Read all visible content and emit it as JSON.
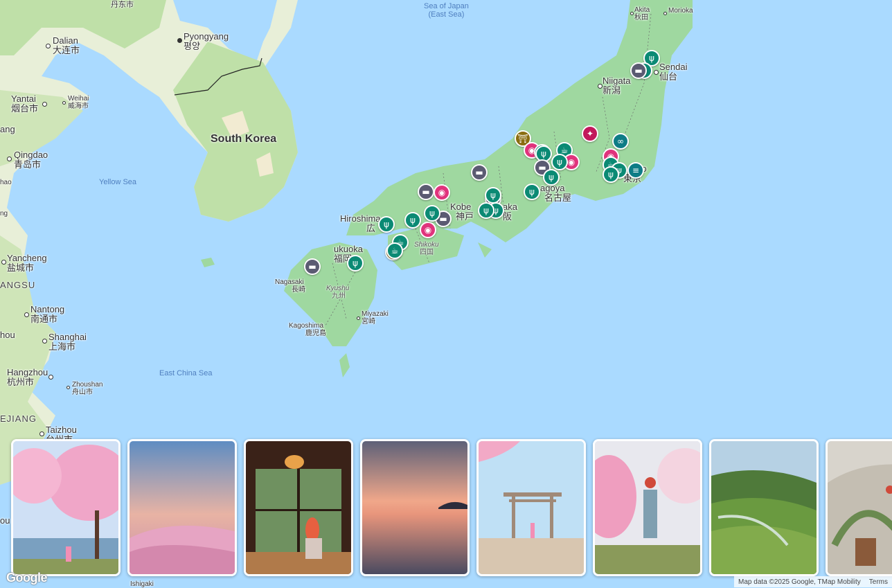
{
  "map": {
    "countries": {
      "south_korea": "South Korea"
    },
    "seas": {
      "sea_of_japan": "Sea of Japan",
      "east_sea": "(East Sea)",
      "yellow_sea": "Yellow Sea",
      "east_china_sea": "East China Sea"
    },
    "cities": {
      "dandong": {
        "name": "丹东市",
        "native": ""
      },
      "dalian": {
        "name": "Dalian",
        "native": "大连市"
      },
      "pyongyang": {
        "name": "Pyongyang",
        "native": "평양"
      },
      "yantai": {
        "name": "Yantai",
        "native": "烟台市"
      },
      "weihai": {
        "name": "Weihai",
        "native": "威海市"
      },
      "qingdao": {
        "name": "Qingdao",
        "native": "青岛市"
      },
      "yancheng": {
        "name": "Yancheng",
        "native": "盐城市"
      },
      "nantong": {
        "name": "Nantong",
        "native": "南通市"
      },
      "shanghai": {
        "name": "Shanghai",
        "native": "上海市"
      },
      "hangzhou": {
        "name": "Hangzhou",
        "native": "杭州市"
      },
      "zhoushan": {
        "name": "Zhoushan",
        "native": "舟山市"
      },
      "taizhou": {
        "name": "Taizhou",
        "native": "台州市"
      },
      "akita": {
        "name": "Akita",
        "native": "秋田"
      },
      "morioka": {
        "name": "Morioka",
        "native": ""
      },
      "sendai": {
        "name": "Sendai",
        "native": "仙台"
      },
      "niigata": {
        "name": "Niigata",
        "native": "新潟"
      },
      "hiroshima": {
        "name": "Hiroshima",
        "native": "広"
      },
      "kobe": {
        "name": "Kobe",
        "native": "神戸"
      },
      "osaka": {
        "name": "aka",
        "native": "阪"
      },
      "nagoya": {
        "name": "agoya",
        "native": "名古屋"
      },
      "tokyo": {
        "name": "yo",
        "native": "東京"
      },
      "fukuoka": {
        "name": "ukuoka",
        "native": "福岡"
      },
      "nagasaki": {
        "name": "Nagasaki",
        "native": "長崎"
      },
      "kagoshima": {
        "name": "Kagoshima",
        "native": "鹿児島"
      },
      "miyazaki": {
        "name": "Miyazaki",
        "native": "宮崎"
      },
      "ishigaki": {
        "name": "Ishigaki",
        "native": ""
      }
    },
    "regions": {
      "shikoku": {
        "name": "Shikoku",
        "native": "四国"
      },
      "kyushu": {
        "name": "Kyushu",
        "native": "九州"
      }
    },
    "provinces": {
      "jiangsu": "ANGSU",
      "zhejiang": "EJIANG"
    },
    "partial_labels": {
      "huang": "ang",
      "hai": "hao",
      "ng": "ng",
      "ou": "hou",
      "ou2": "ou"
    }
  },
  "pin_colors": {
    "food": "#0b8a74",
    "cafe": "#0b8a74",
    "hotel": "#5b5b72",
    "photo": "#e0337c",
    "sight": "#0e7c86",
    "shrine": "#8a6d10",
    "nightlife": "#c2185b"
  },
  "pins": [
    {
      "type": "food",
      "icon": "ψ"
    },
    {
      "type": "food",
      "icon": "ψ"
    },
    {
      "type": "hotel",
      "icon": "▬"
    },
    {
      "type": "shrine",
      "icon": "⛩"
    },
    {
      "type": "photo",
      "icon": "◉"
    },
    {
      "type": "food",
      "icon": "ψ"
    },
    {
      "type": "nightlife",
      "icon": "✦"
    },
    {
      "type": "sight",
      "icon": "∞"
    },
    {
      "type": "cafe",
      "icon": "☕"
    },
    {
      "type": "food",
      "icon": "ψ"
    },
    {
      "type": "hotel",
      "icon": "▬"
    },
    {
      "type": "photo",
      "icon": "◉"
    },
    {
      "type": "food",
      "icon": "ψ"
    },
    {
      "type": "photo",
      "icon": "◉"
    },
    {
      "type": "cafe",
      "icon": "☕"
    },
    {
      "type": "food",
      "icon": "ψ"
    },
    {
      "type": "food",
      "icon": "ψ"
    },
    {
      "type": "sight",
      "icon": "≡"
    },
    {
      "type": "food",
      "icon": "ψ"
    },
    {
      "type": "hotel",
      "icon": "▬"
    },
    {
      "type": "hotel",
      "icon": "▬"
    },
    {
      "type": "photo",
      "icon": "◉"
    },
    {
      "type": "food",
      "icon": "ψ"
    },
    {
      "type": "hotel",
      "icon": "▬"
    },
    {
      "type": "food",
      "icon": "ψ"
    },
    {
      "type": "food",
      "icon": "ψ"
    },
    {
      "type": "food",
      "icon": "ψ"
    },
    {
      "type": "photo",
      "icon": "◉"
    },
    {
      "type": "hotel",
      "icon": "▬"
    },
    {
      "type": "food",
      "icon": "ψ"
    },
    {
      "type": "cafe",
      "icon": "☕"
    },
    {
      "type": "shrine",
      "icon": "⛩"
    },
    {
      "type": "cafe",
      "icon": "☕"
    },
    {
      "type": "food",
      "icon": "ψ"
    },
    {
      "type": "food",
      "icon": "ψ"
    },
    {
      "type": "hotel",
      "icon": "▬"
    },
    {
      "type": "food",
      "icon": "ψ"
    }
  ],
  "photo_cards": [
    {
      "name": "cherry-blossom-lake"
    },
    {
      "name": "sunrise-cherry-hills"
    },
    {
      "name": "ryokan-window"
    },
    {
      "name": "sunset-reflection"
    },
    {
      "name": "torii-gate"
    },
    {
      "name": "blossom-garden"
    },
    {
      "name": "rice-terraces"
    },
    {
      "name": "ghibli-house"
    }
  ],
  "attribution": {
    "logo": "Google",
    "map_data": "Map data ©2025 Google, TMap Mobility",
    "terms": "Terms"
  }
}
